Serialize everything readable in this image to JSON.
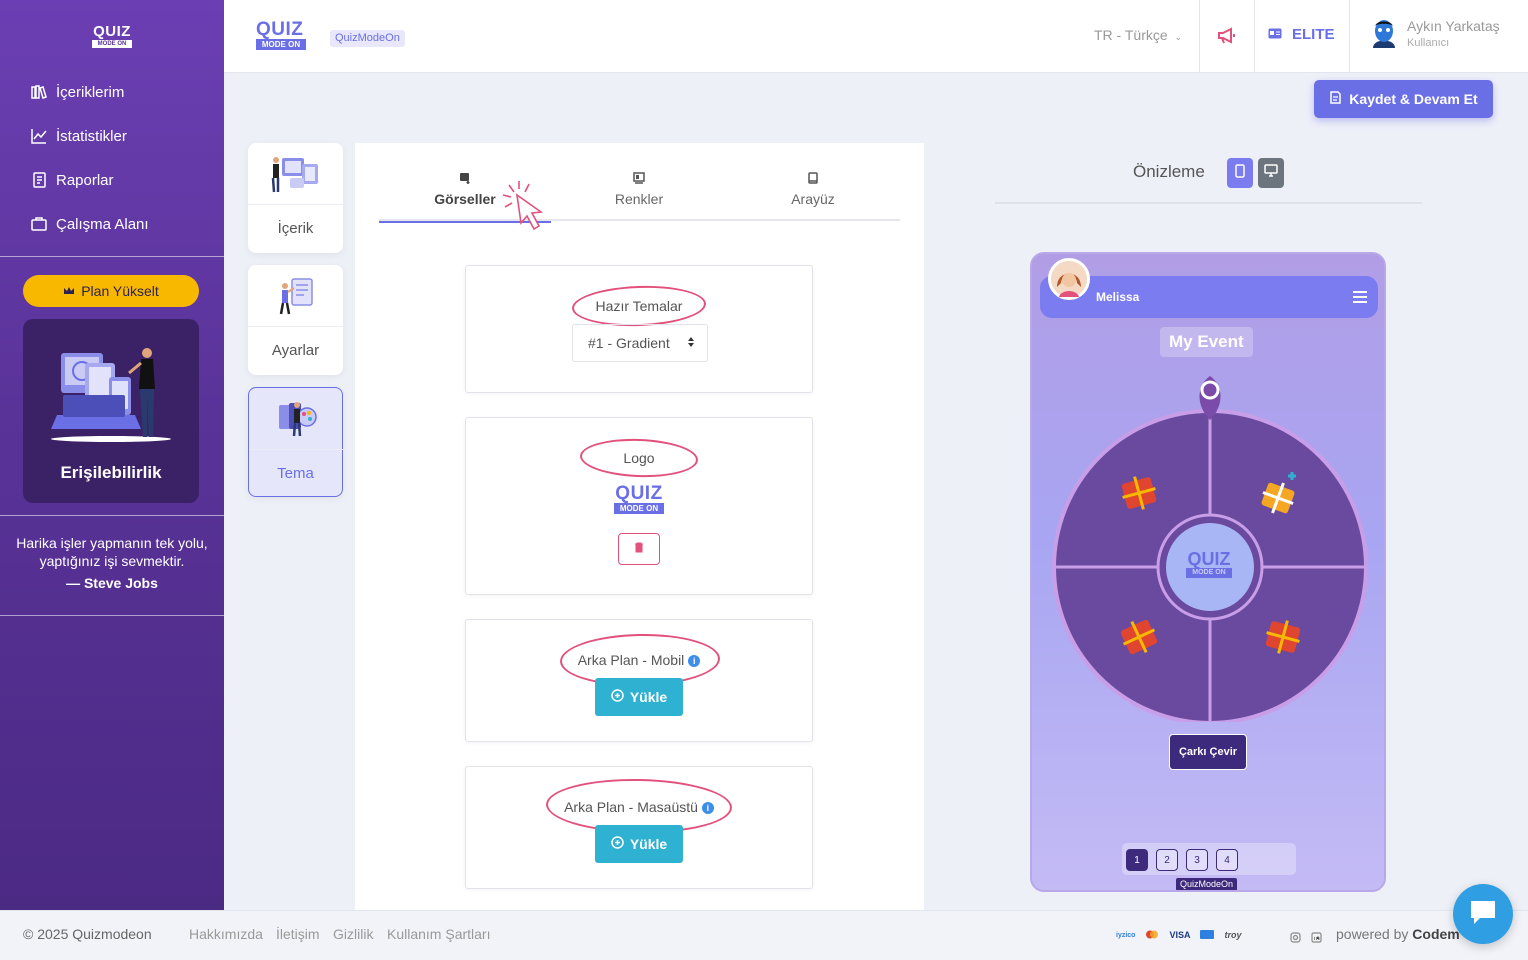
{
  "sidebar": {
    "logo": {
      "quiz": "QUIZ",
      "mode": "MODE ON"
    },
    "nav": [
      {
        "label": "İçeriklerim",
        "icon": "books-icon"
      },
      {
        "label": "İstatistikler",
        "icon": "line-chart-icon"
      },
      {
        "label": "Raporlar",
        "icon": "report-icon"
      },
      {
        "label": "Çalışma Alanı",
        "icon": "briefcase-icon"
      }
    ],
    "upgrade_label": "Plan Yükselt",
    "access_title": "Erişilebilirlik",
    "quote": "Harika işler yapmanın tek yolu, yaptığınız işi sevmektir.",
    "quote_author": "— Steve Jobs"
  },
  "header": {
    "logo": {
      "quiz": "QUIZ",
      "mode": "MODE ON"
    },
    "badge": "QuizModeOn",
    "language": "TR - Türkçe",
    "plan": "ELITE",
    "user_name": "Aykın Yarkataş",
    "user_role": "Kullanıcı"
  },
  "toolbar": {
    "save_label": "Kaydet & Devam Et"
  },
  "steps": [
    {
      "label": "İçerik",
      "active": false
    },
    {
      "label": "Ayarlar",
      "active": false
    },
    {
      "label": "Tema",
      "active": true
    }
  ],
  "tabs": [
    {
      "label": "Görseller",
      "active": true
    },
    {
      "label": "Renkler",
      "active": false
    },
    {
      "label": "Arayüz",
      "active": false
    }
  ],
  "cards": {
    "themes": {
      "title": "Hazır Temalar",
      "selected": "#1 - Gradient"
    },
    "logo": {
      "title": "Logo",
      "quiz": "QUIZ",
      "mode": "MODE ON"
    },
    "bg_mobile": {
      "title": "Arka Plan - Mobil",
      "button": "Yükle"
    },
    "bg_desktop": {
      "title": "Arka Plan - Masaüstü",
      "button": "Yükle"
    }
  },
  "preview": {
    "title": "Önizleme",
    "player_name": "Melissa",
    "event_title": "My Event",
    "wheel_logo": {
      "quiz": "QUIZ",
      "mode": "MODE ON"
    },
    "spin_label": "Çarkı Çevir",
    "pages": [
      "1",
      "2",
      "3",
      "4"
    ],
    "active_page": "1",
    "brand": "QuizModeOn"
  },
  "footer": {
    "copyright": "© 2025 Quizmodeon",
    "links": [
      "Hakkımızda",
      "İletişim",
      "Gizlilik",
      "Kullanım Şartları"
    ],
    "payments": [
      "iyzico",
      "mastercard",
      "VISA",
      "amex",
      "troy"
    ],
    "powered_prefix": "powered by",
    "powered_name": "Codem"
  },
  "colors": {
    "accent": "#6a6fe6",
    "sidebar": "#5a3399",
    "upgrade": "#f8b800",
    "upload": "#2fb1d1",
    "annotation": "#e2517c"
  }
}
